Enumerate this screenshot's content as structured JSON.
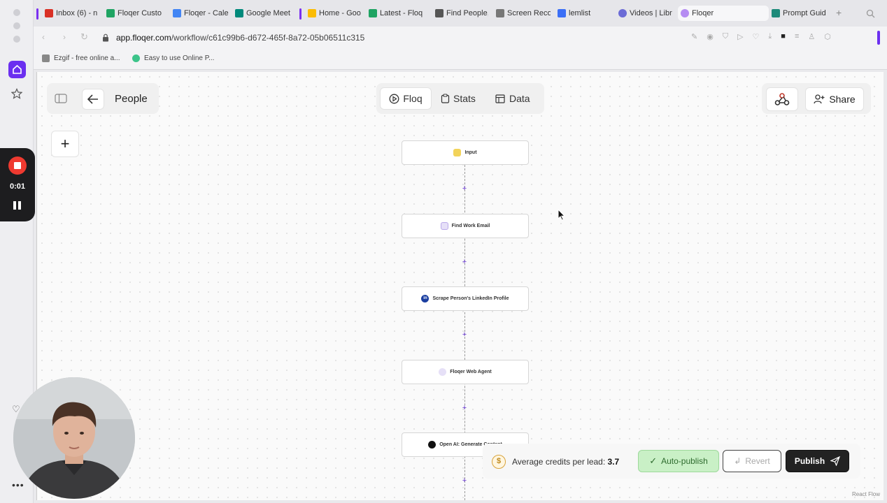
{
  "browser": {
    "tabs": [
      {
        "label": "Inbox (6) - n",
        "color": "#d93025"
      },
      {
        "label": "Floqer Custo",
        "color": "#1fa463"
      },
      {
        "label": "Floqer - Cale",
        "color": "#4285f4"
      },
      {
        "label": "Google Meet",
        "color": "#00897b"
      },
      {
        "label": "Home - Goo",
        "color": "#fbbc04"
      },
      {
        "label": "Latest - Floq",
        "color": "#1fa463"
      },
      {
        "label": "Find People,",
        "color": "#555555"
      },
      {
        "label": "Screen Reco",
        "color": "#777777"
      },
      {
        "label": "lemlist",
        "color": "#3b6ff6"
      },
      {
        "label": "Videos | Libr",
        "color": "#6b6bd6"
      },
      {
        "label": "Floqer",
        "color": "#b58cf2"
      },
      {
        "label": "Prompt Guid",
        "color": "#1d8a7a"
      }
    ],
    "url_host": "app.floqer.com",
    "url_path": "/workflow/c61c99b6-d672-465f-8a72-05b06511c315",
    "bookmarks": [
      {
        "label": "Ezgif - free online a...",
        "color": "#888888"
      },
      {
        "label": "Easy to use Online P...",
        "color": "#3cc48a"
      }
    ]
  },
  "recorder": {
    "time": "0:01"
  },
  "app": {
    "page_title": "People",
    "view_tabs": [
      {
        "label": "Floq",
        "icon": "play-circle-icon",
        "active": true
      },
      {
        "label": "Stats",
        "icon": "clipboard-icon",
        "active": false
      },
      {
        "label": "Data",
        "icon": "table-icon",
        "active": false
      }
    ],
    "share_label": "Share",
    "flow_nodes": [
      {
        "label": "Input",
        "icon": "file-icon",
        "color": "#f2d35a"
      },
      {
        "label": "Find Work Email",
        "icon": "email-icon",
        "color": "#e6e0f7"
      },
      {
        "label": "Scrape Person's LinkedIn Profile",
        "icon": "linkedin-icon",
        "color": "#1a3ea0"
      },
      {
        "label": "Floqer Web Agent",
        "icon": "agent-icon",
        "color": "#e6e0f7"
      },
      {
        "label": "Open AI: Generate Content",
        "icon": "openai-icon",
        "color": "#111111"
      }
    ],
    "credits_label": "Average credits per lead:",
    "credits_value": "3.7",
    "autopublish_label": "Auto-publish",
    "revert_label": "Revert",
    "publish_label": "Publish",
    "attribution": "React Flow"
  }
}
